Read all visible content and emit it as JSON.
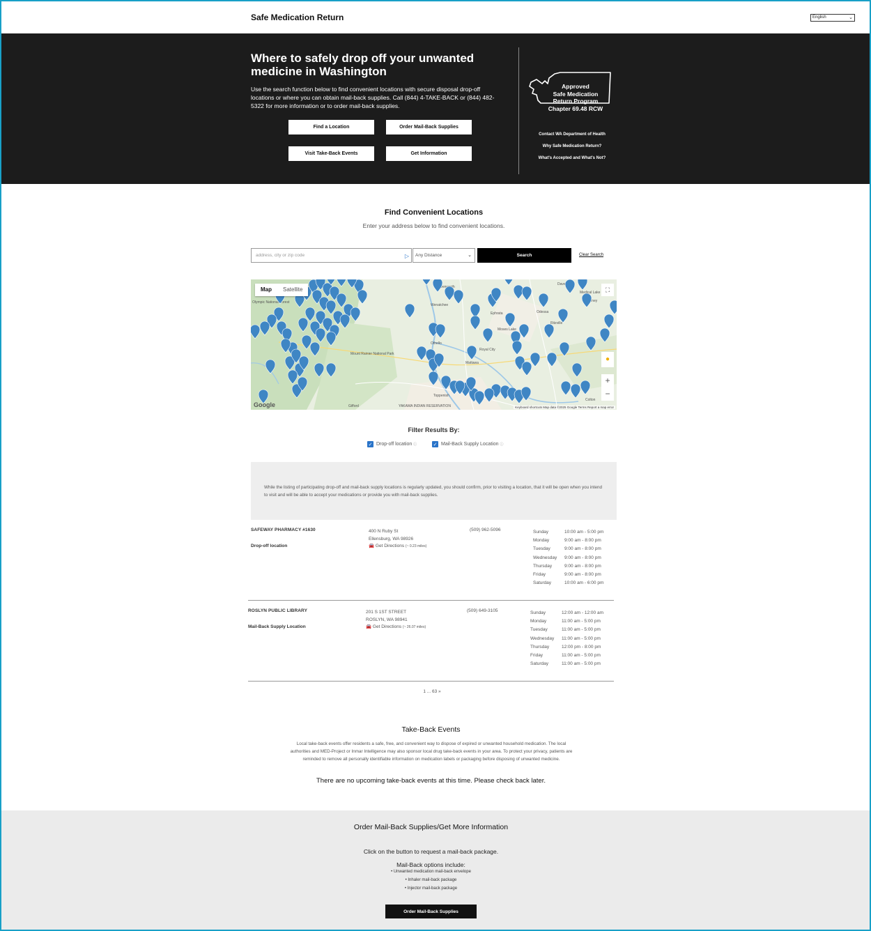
{
  "header": {
    "brand": "Safe Medication Return",
    "language": "English"
  },
  "hero": {
    "title": "Where to safely drop off your unwanted medicine in Washington",
    "description": "Use the search function below to find convenient locations with secure disposal drop-off locations or where you can obtain mail-back supplies. Call (844) 4-TAKE-BACK or (844) 482-5322 for more information or to order mail-back supplies.",
    "buttons": [
      "Find a Location",
      "Order Mail-Back Supplies",
      "Visit Take-Back Events",
      "Get Information"
    ],
    "badge_lines": [
      "Approved",
      "Safe Medication",
      "Return Program",
      "Chapter 69.48 RCW"
    ],
    "links": [
      "Contact WA Department of Health",
      "Why Safe Medication Return?",
      "What's Accepted and What's Not?"
    ]
  },
  "find": {
    "title": "Find Convenient Locations",
    "subtitle": "Enter your address below to find convenient locations.",
    "search_placeholder": "address, city or zip code",
    "distance_value": "Any Distance",
    "search_label": "Search",
    "clear_label": "Clear Search"
  },
  "map": {
    "tab_map": "Map",
    "tab_satellite": "Satellite",
    "google": "Google",
    "attribution": "Keyboard shortcuts   Map data ©2025 Google   Terms   Report a map error",
    "place_labels": [
      "Olympic National Forest",
      "Mount Rainier National Park",
      "Gifford",
      "Leavenworth",
      "Wenatchee",
      "Ephrata",
      "Moses Lake",
      "Odessa",
      "Ritzville",
      "Davenport",
      "Medical Lake",
      "Cheney",
      "Othello",
      "Mattawa",
      "Royal City",
      "Toppenish",
      "YAKAMA INDIAN RESERVATION",
      "Colton"
    ],
    "marker_color": "#3f86c4"
  },
  "filter": {
    "title": "Filter Results By:",
    "options": [
      "Drop-off location",
      "Mail-Back Supply Location"
    ]
  },
  "notice": "While the listing of participating drop-off and mail-back supply locations is regularly updated, you should confirm, prior to visiting a location, that it will be open when you intend to visit and will be able to accept your medications or provide you with mail-back supplies.",
  "locations": [
    {
      "name": "SAFEWAY PHARMACY #1630",
      "type": "Drop-off location",
      "address1": "400 N Ruby St",
      "address2": "Ellensburg, WA 98926",
      "directions": "Get Directions",
      "miles": "(~ 0.23 miles)",
      "phone": "(509) 962-5096",
      "hours": [
        {
          "day": "Sunday",
          "time": "10:00 am - 5:00 pm"
        },
        {
          "day": "Monday",
          "time": "9:00 am - 8:00 pm"
        },
        {
          "day": "Tuesday",
          "time": "9:00 am - 8:00 pm"
        },
        {
          "day": "Wednesday",
          "time": "9:00 am - 8:00 pm"
        },
        {
          "day": "Thursday",
          "time": "9:00 am - 8:00 pm"
        },
        {
          "day": "Friday",
          "time": "9:00 am - 8:00 pm"
        },
        {
          "day": "Saturday",
          "time": "10:00 am - 6:00 pm"
        }
      ]
    },
    {
      "name": "ROSLYN PUBLIC LIBRARY",
      "type": "Mail-Back Supply Location",
      "address1": "201 S 1ST STREET",
      "address2": "ROSLYN, WA 98941",
      "directions": "Get Directions",
      "miles": "(~ 26.07 miles)",
      "phone": "(509) 649-3105",
      "hours": [
        {
          "day": "Sunday",
          "time": "12:00 am - 12:00 am"
        },
        {
          "day": "Monday",
          "time": "11:00 am - 5:00 pm"
        },
        {
          "day": "Tuesday",
          "time": "11:00 am - 5:00 pm"
        },
        {
          "day": "Wednesday",
          "time": "11:00 am - 5:00 pm"
        },
        {
          "day": "Thursday",
          "time": "12:00 pm - 8:00 pm"
        },
        {
          "day": "Friday",
          "time": "11:00 am - 5:00 pm"
        },
        {
          "day": "Saturday",
          "time": "11:00 am - 5:00 pm"
        }
      ]
    }
  ],
  "pagination": "1 ... 63 »",
  "takeback": {
    "title": "Take-Back Events",
    "text": "Local take-back events offer residents a safe, free, and convenient way to dispose of expired or unwanted household medication. The local authorities and MED-Project or Inmar Intelligence may also sponsor local drug take-back events in your area. To protect your privacy, patients are reminded to remove all personally identifiable information on medication labels or packaging before disposing of unwanted medicine.",
    "none": "There are no upcoming take-back events at this time. Please check back later."
  },
  "footer": {
    "title": "Order Mail-Back Supplies/Get More Information",
    "click_text": "Click on the button to request a mail-back package.",
    "options_title": "Mail-Back options include:",
    "options": [
      "• Unwanted medication mail-back envelope",
      "• Inhaler mail-back package",
      "• Injector mail-back package"
    ],
    "button": "Order Mail-Back Supplies"
  }
}
